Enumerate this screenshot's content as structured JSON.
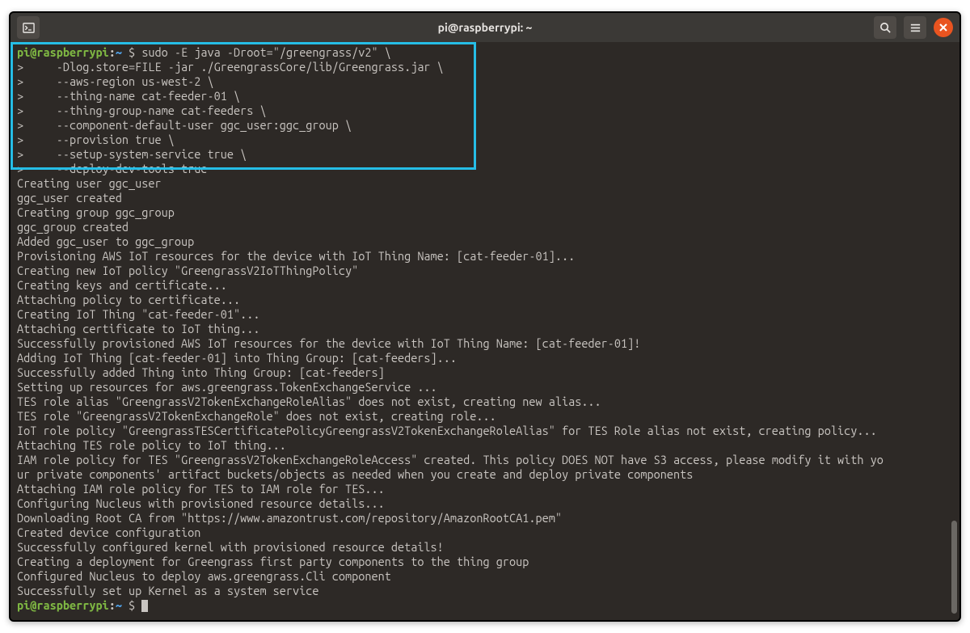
{
  "window": {
    "title": "pi@raspberrypi: ~"
  },
  "prompt": {
    "user_host": "pi@raspberrypi",
    "colon": ":",
    "path": "~",
    "dollar": " $ "
  },
  "command": {
    "line1": "sudo -E java -Droot=\"/greengrass/v2\" \\",
    "line2": ">     -Dlog.store=FILE -jar ./GreengrassCore/lib/Greengrass.jar \\",
    "line3": ">     --aws-region us-west-2 \\",
    "line4": ">     --thing-name cat-feeder-01 \\",
    "line5": ">     --thing-group-name cat-feeders \\",
    "line6": ">     --component-default-user ggc_user:ggc_group \\",
    "line7": ">     --provision true \\",
    "line8": ">     --setup-system-service true \\",
    "line9": ">     --deploy-dev-tools true"
  },
  "output": [
    "Creating user ggc_user",
    "ggc_user created",
    "Creating group ggc_group",
    "ggc_group created",
    "Added ggc_user to ggc_group",
    "Provisioning AWS IoT resources for the device with IoT Thing Name: [cat-feeder-01]...",
    "Creating new IoT policy \"GreengrassV2IoTThingPolicy\"",
    "Creating keys and certificate...",
    "Attaching policy to certificate...",
    "Creating IoT Thing \"cat-feeder-01\"...",
    "Attaching certificate to IoT thing...",
    "Successfully provisioned AWS IoT resources for the device with IoT Thing Name: [cat-feeder-01]!",
    "Adding IoT Thing [cat-feeder-01] into Thing Group: [cat-feeders]...",
    "Successfully added Thing into Thing Group: [cat-feeders]",
    "Setting up resources for aws.greengrass.TokenExchangeService ...",
    "TES role alias \"GreengrassV2TokenExchangeRoleAlias\" does not exist, creating new alias...",
    "TES role \"GreengrassV2TokenExchangeRole\" does not exist, creating role...",
    "IoT role policy \"GreengrassTESCertificatePolicyGreengrassV2TokenExchangeRoleAlias\" for TES Role alias not exist, creating policy...",
    "Attaching TES role policy to IoT thing...",
    "IAM role policy for TES \"GreengrassV2TokenExchangeRoleAccess\" created. This policy DOES NOT have S3 access, please modify it with yo",
    "ur private components' artifact buckets/objects as needed when you create and deploy private components",
    "Attaching IAM role policy for TES to IAM role for TES...",
    "Configuring Nucleus with provisioned resource details...",
    "Downloading Root CA from \"https://www.amazontrust.com/repository/AmazonRootCA1.pem\"",
    "Created device configuration",
    "Successfully configured kernel with provisioned resource details!",
    "Creating a deployment for Greengrass first party components to the thing group",
    "Configured Nucleus to deploy aws.greengrass.Cli component",
    "Successfully set up Kernel as a system service"
  ]
}
